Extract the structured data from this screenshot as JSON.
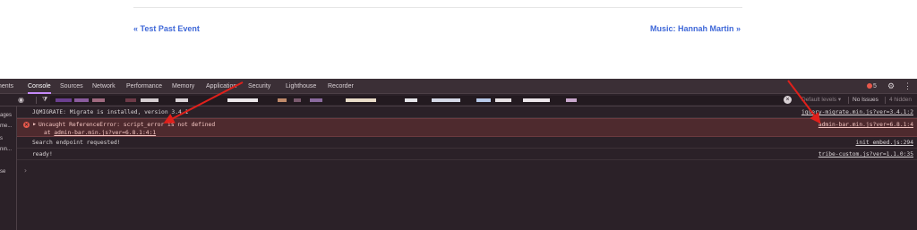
{
  "page": {
    "prev_link": "« Test Past Event",
    "next_link": "Music: Hannah Martin »"
  },
  "devtools": {
    "tabs": [
      "ments",
      "Console",
      "Sources",
      "Network",
      "Performance",
      "Memory",
      "Application",
      "Security",
      "Lighthouse",
      "Recorder"
    ],
    "active_tab": "Console",
    "error_count": "5",
    "icons": {
      "gear": "gear-icon",
      "more": "kebab-menu-icon",
      "eye": "eye-icon",
      "filter": "funnel-icon",
      "clear": "clear-icon",
      "error": "error-icon"
    },
    "filter": {
      "levels_label": "Default levels ▾",
      "issues_label": "No Issues",
      "hidden_label": "4 hidden"
    },
    "sidebar": [
      "ages",
      "me...",
      "s",
      "nin...",
      "",
      "se"
    ],
    "messages": [
      {
        "type": "log",
        "text": "JQMIGRATE: Migrate is installed, version 3.4.1",
        "source": "jquery-migrate.min.js?ver=3.4.1:2"
      },
      {
        "type": "error",
        "text": "Uncaught ReferenceError: script_error is not defined",
        "detail_prefix": "at ",
        "detail_link": "admin-bar.min.js?ver=6.8.1:4:1",
        "source": "admin-bar.min.js?ver=6.8.1:4"
      },
      {
        "type": "log",
        "text": "Search endpoint requested!",
        "source": "init_embed.js:294"
      },
      {
        "type": "log",
        "text": "ready!",
        "source": "tribe-custom.js?ver=1.1.0:35"
      }
    ],
    "prompt": "›"
  },
  "colors": {
    "link_blue": "#3f68d8",
    "devtools_bg": "#2b2128",
    "error_row_bg": "#4e2a2e",
    "annotation_arrow": "#e0201b",
    "active_tab_underline": "#c58af9"
  }
}
